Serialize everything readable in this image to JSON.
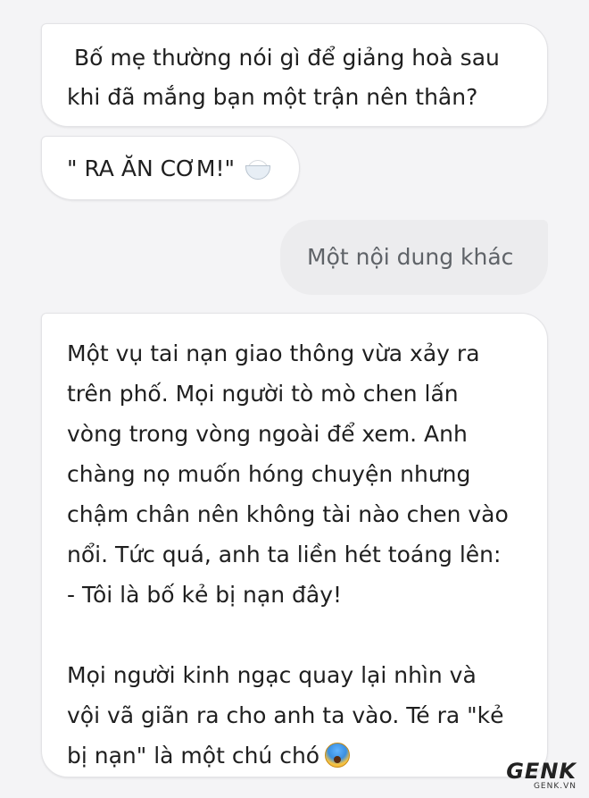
{
  "messages": [
    {
      "sender": "assistant",
      "text": " Bố mẹ thường nói gì để giảng hoà sau\nkhi đã mắng bạn một trận nên thân?"
    },
    {
      "sender": "assistant",
      "text": "\" RA ĂN CƠM!\"",
      "icon": "rice-bowl-icon"
    },
    {
      "sender": "user-suggestion",
      "text": "Một nội dung khác"
    },
    {
      "sender": "assistant",
      "text": "Một vụ tai nạn giao thông vừa xảy ra\ntrên phố. Mọi người tò mò chen lấn\nvòng trong vòng ngoài để xem. Anh\nchàng nọ muốn hóng chuyện nhưng\nchậm chân nên không tài nào chen vào\nnổi. Tức quá, anh ta liền hét toáng lên:\n- Tôi là bố kẻ bị nạn đây!\n\nMọi người kinh ngạc quay lại nhìn và\nvội vã giãn ra cho anh ta vào. Té ra \"kẻ\nbị nạn\" là một chú chó",
      "icon": "face-screaming-in-fear-icon"
    }
  ],
  "watermark": {
    "logo": "GENK",
    "site": "GENK.VN"
  },
  "colors": {
    "background": "#f4f4f6",
    "bubble": "#ffffff",
    "suggestion_bubble": "#ececee",
    "suggestion_text": "#5f6368"
  }
}
